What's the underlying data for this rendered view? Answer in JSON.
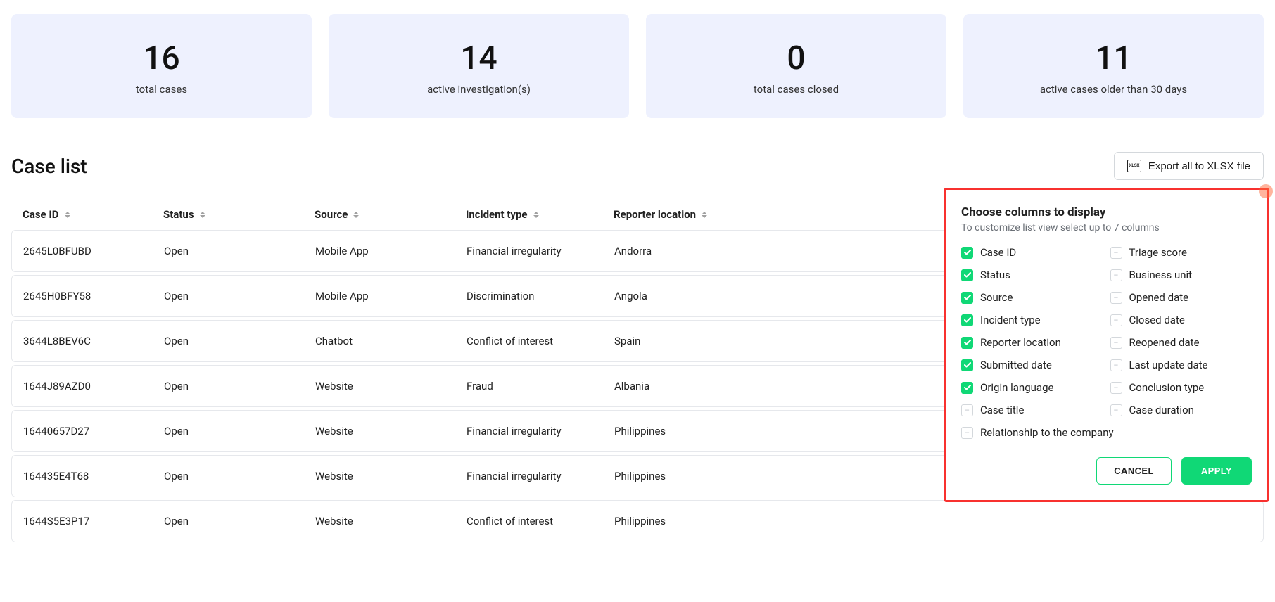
{
  "stats": [
    {
      "value": "16",
      "label": "total cases"
    },
    {
      "value": "14",
      "label": "active investigation(s)"
    },
    {
      "value": "0",
      "label": "total cases closed"
    },
    {
      "value": "11",
      "label": "active cases older than 30 days"
    }
  ],
  "page_title": "Case list",
  "export_button_label": "Export all to XLSX file",
  "export_icon_text": "XLSX",
  "columns": [
    {
      "key": "case_id",
      "label": "Case ID"
    },
    {
      "key": "status",
      "label": "Status"
    },
    {
      "key": "source",
      "label": "Source"
    },
    {
      "key": "incident",
      "label": "Incident type"
    },
    {
      "key": "reporter",
      "label": "Reporter location"
    }
  ],
  "rows": [
    {
      "case_id": "2645L0BFUBD",
      "status": "Open",
      "source": "Mobile App",
      "incident": "Financial irregularity",
      "reporter": "Andorra"
    },
    {
      "case_id": "2645H0BFY58",
      "status": "Open",
      "source": "Mobile App",
      "incident": "Discrimination",
      "reporter": "Angola"
    },
    {
      "case_id": "3644L8BEV6C",
      "status": "Open",
      "source": "Chatbot",
      "incident": "Conflict of interest",
      "reporter": "Spain"
    },
    {
      "case_id": "1644J89AZD0",
      "status": "Open",
      "source": "Website",
      "incident": "Fraud",
      "reporter": "Albania"
    },
    {
      "case_id": "16440657D27",
      "status": "Open",
      "source": "Website",
      "incident": "Financial irregularity",
      "reporter": "Philippines"
    },
    {
      "case_id": "164435E4T68",
      "status": "Open",
      "source": "Website",
      "incident": "Financial irregularity",
      "reporter": "Philippines"
    },
    {
      "case_id": "1644S5E3P17",
      "status": "Open",
      "source": "Website",
      "incident": "Conflict of interest",
      "reporter": "Philippines"
    }
  ],
  "popup": {
    "title": "Choose columns to display",
    "subtitle": "To customize list view select up to 7 columns",
    "options_left": [
      {
        "label": "Case ID",
        "checked": true
      },
      {
        "label": "Status",
        "checked": true
      },
      {
        "label": "Source",
        "checked": true
      },
      {
        "label": "Incident type",
        "checked": true
      },
      {
        "label": "Reporter location",
        "checked": true
      },
      {
        "label": "Submitted date",
        "checked": true
      },
      {
        "label": "Origin language",
        "checked": true
      },
      {
        "label": "Case title",
        "checked": false
      }
    ],
    "options_right": [
      {
        "label": "Triage score",
        "checked": false
      },
      {
        "label": "Business unit",
        "checked": false
      },
      {
        "label": "Opened date",
        "checked": false
      },
      {
        "label": "Closed date",
        "checked": false
      },
      {
        "label": "Reopened date",
        "checked": false
      },
      {
        "label": "Last update date",
        "checked": false
      },
      {
        "label": "Conclusion type",
        "checked": false
      },
      {
        "label": "Case duration",
        "checked": false
      }
    ],
    "option_bottom": {
      "label": "Relationship to the company",
      "checked": false
    },
    "cancel": "CANCEL",
    "apply": "APPLY"
  }
}
